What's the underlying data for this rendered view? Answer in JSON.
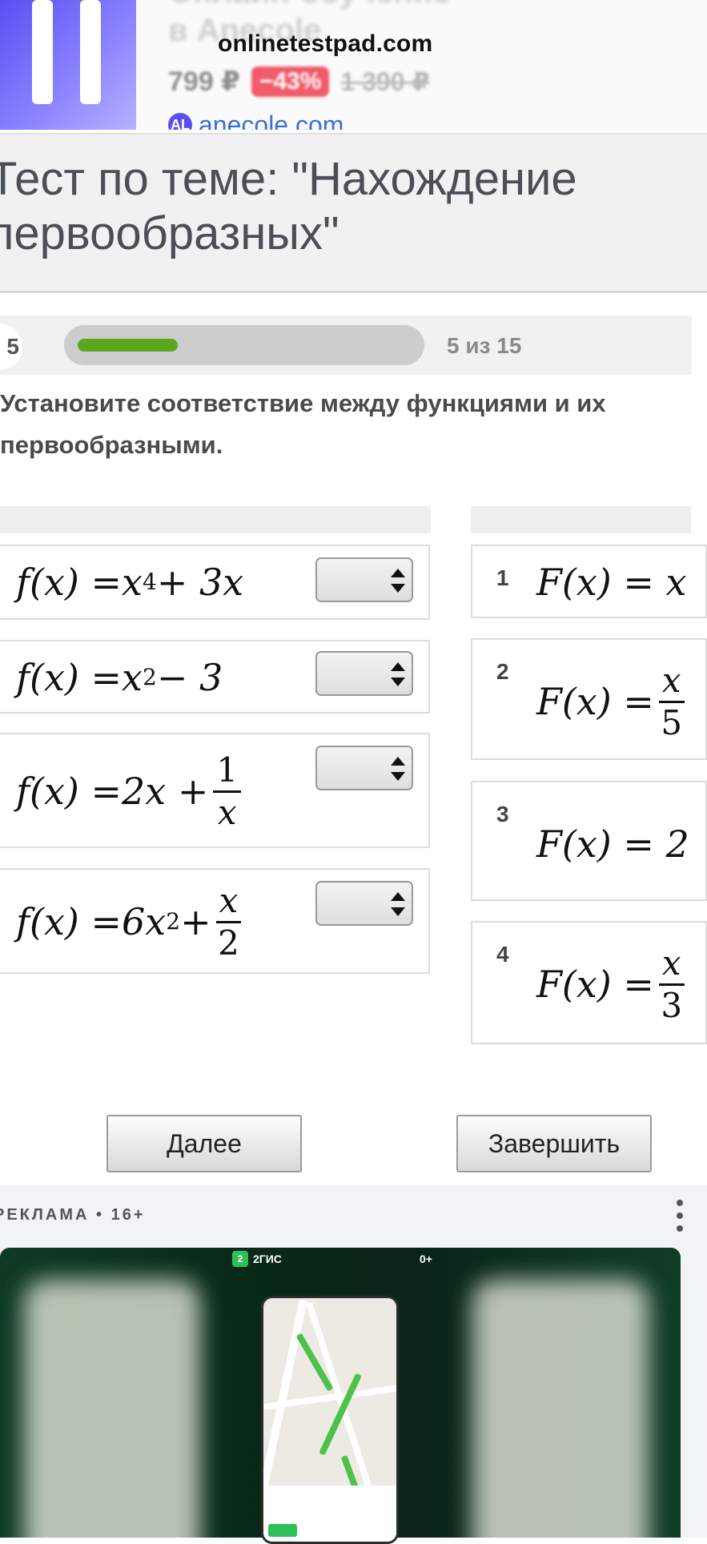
{
  "top_ad": {
    "title_line1": "Онлайн-обучение",
    "title_line2": "в Anecole",
    "price_new": "799 ₽",
    "discount": "−43%",
    "price_old": "1 390 ₽",
    "domain_icon": "AL",
    "domain": "anecole.com"
  },
  "site_url": "onlinetestpad.com",
  "test": {
    "title": "Тест по теме: \"Нахождение первообразных\"",
    "progress": {
      "current_number": "5",
      "label": "5 из 15",
      "fraction": 0.333
    },
    "question": "Установите соответствие между функциями и их первообразными."
  },
  "left_items": [
    {
      "lhs": "f(x) = ",
      "body": "x",
      "sup": "4",
      "tail": " + 3x"
    },
    {
      "lhs": "f(x) = ",
      "body": "x",
      "sup": "2",
      "tail": " − 3"
    },
    {
      "lhs": "f(x) = ",
      "body": "2x + ",
      "frac_num": "1",
      "frac_den": "x"
    },
    {
      "lhs": "f(x) = ",
      "body": "6x",
      "sup": "2",
      "tail": " + ",
      "frac_num": "x",
      "frac_den": "2"
    }
  ],
  "right_items": [
    {
      "number": "1",
      "formula": "F(x) = x"
    },
    {
      "number": "2",
      "formula": "F(x) = ",
      "frac_num": "x",
      "frac_den": "5"
    },
    {
      "number": "3",
      "formula": "F(x) = 2"
    },
    {
      "number": "4",
      "formula": "F(x) = ",
      "frac_num": "x",
      "frac_den": "3"
    }
  ],
  "buttons": {
    "next": "Далее",
    "finish": "Завершить"
  },
  "bottom_ad": {
    "label": "РЕКЛАМА • 16+",
    "logo_text": "2ГИС",
    "logo_icon": "2",
    "age": "0+"
  },
  "colors": {
    "progress_fill": "#5aa71e",
    "ad_discount": "#f15b6a",
    "ad_link": "#3d6fd8"
  },
  "icons": [
    "select-arrows-icon",
    "more-vertical-icon",
    "anecole-logo-icon",
    "2gis-logo-icon"
  ]
}
